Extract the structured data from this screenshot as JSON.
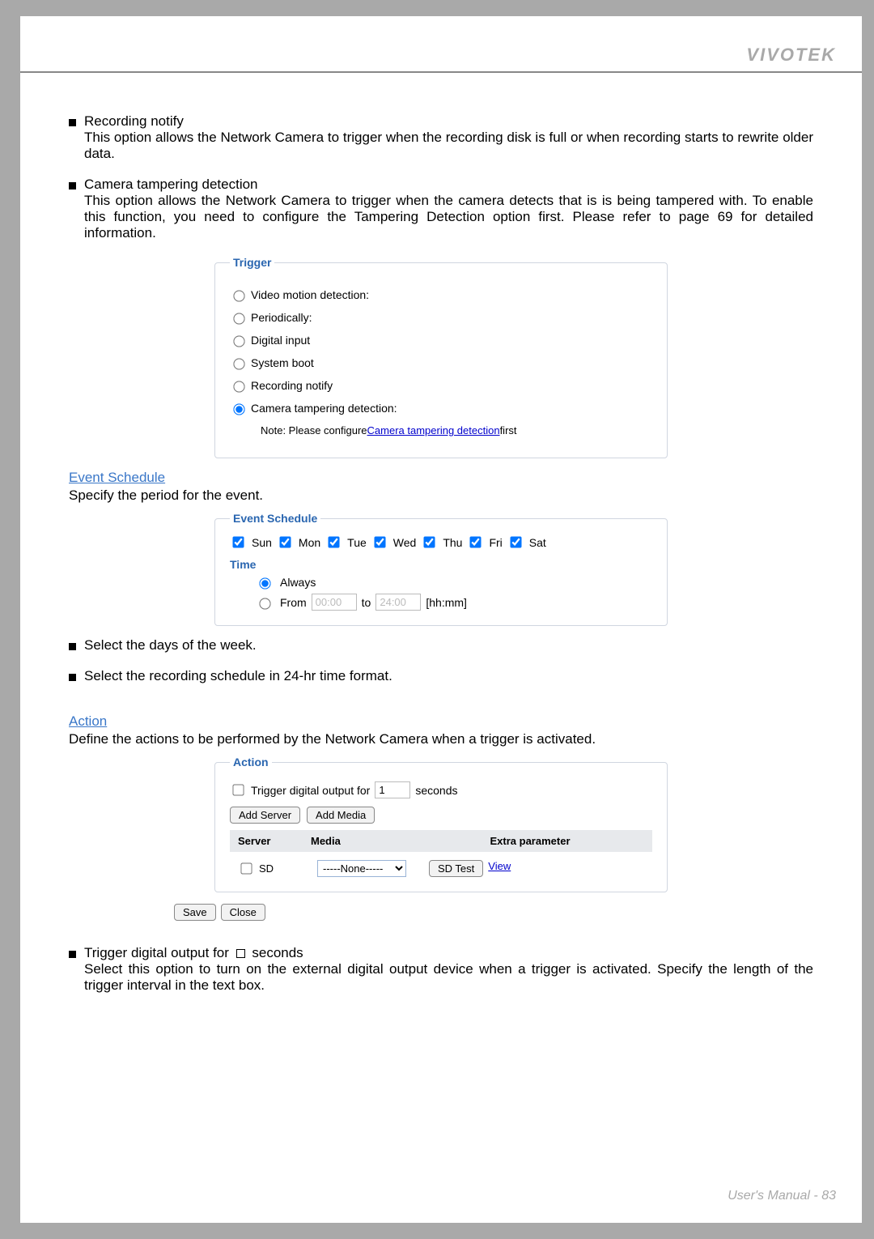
{
  "brand": "VIVOTEK",
  "footer": "User's Manual - 83",
  "intro": {
    "recording_notify": {
      "title": "Recording notify",
      "body": "This option allows the Network Camera to trigger when the recording disk is full or when recording starts to rewrite older data."
    },
    "tampering": {
      "title": "Camera tampering detection",
      "body": "This option allows the Network Camera to trigger when the camera detects that is is being tampered with. To enable this function, you need to configure the Tampering Detection option first. Please refer to page 69 for detailed information."
    }
  },
  "trigger_panel": {
    "legend": "Trigger",
    "options": [
      "Video motion detection:",
      "Periodically:",
      "Digital input",
      "System boot",
      "Recording notify",
      "Camera tampering detection:"
    ],
    "selected_index": 5,
    "note_prefix": "Note: Please configure ",
    "note_link": "Camera tampering detection",
    "note_suffix": " first"
  },
  "event_schedule": {
    "heading": "Event Schedule",
    "desc": "Specify the period for the event.",
    "legend": "Event Schedule",
    "days": [
      "Sun",
      "Mon",
      "Tue",
      "Wed",
      "Thu",
      "Fri",
      "Sat"
    ],
    "time_label": "Time",
    "always": "Always",
    "from": "From",
    "from_val": "00:00",
    "to": "to",
    "to_val": "24:00",
    "fmt": "[hh:mm]",
    "bullets": [
      "Select the days of the week.",
      "Select the recording schedule in 24-hr time format."
    ]
  },
  "action": {
    "heading": "Action",
    "desc": "Define the actions to be performed by the Network Camera when a trigger is activated.",
    "legend": "Action",
    "dout_prefix": "Trigger digital output for",
    "dout_value": "1",
    "dout_suffix": "seconds",
    "add_server": "Add Server",
    "add_media": "Add Media",
    "col_server": "Server",
    "col_media": "Media",
    "col_extra": "Extra parameter",
    "row_sd": "SD",
    "media_none": "-----None-----",
    "sd_test": "SD Test",
    "view": "View",
    "save": "Save",
    "close": "Close",
    "bullet_title_prefix": "Trigger digital output for ",
    "bullet_title_suffix": " seconds",
    "bullet_body": "Select this option to turn on the external digital output device when a trigger is activated. Specify the length of the trigger interval in the text box."
  }
}
